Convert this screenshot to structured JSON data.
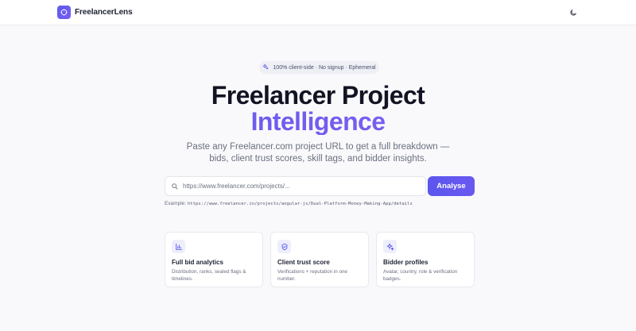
{
  "header": {
    "brand": "FreelancerLens",
    "logo_icon": "sparkle-logo-icon",
    "theme_icon": "moon-icon"
  },
  "hero": {
    "badge_icon": "sparkles-icon",
    "badge": "100% client-side · No signup · Ephemeral",
    "title_line1": "Freelancer Project",
    "title_line2": "Intelligence",
    "subtitle_line1": "Paste any Freelancer.com project URL to get a full breakdown —",
    "subtitle_line2": "bids, client trust scores, skill tags, and bidder insights."
  },
  "search": {
    "placeholder": "https://www.freelancer.com/projects/...",
    "value": "",
    "button_label": "Analyse",
    "example_label": "Example:",
    "example_url": "https://www.freelancer.in/projects/angular-js/Dual-Platform-Money-Making-App/details"
  },
  "features": [
    {
      "icon": "bar-chart-icon",
      "title": "Full bid analytics",
      "desc": "Distribution, ranks, sealed flags & timelines."
    },
    {
      "icon": "shield-check-icon",
      "title": "Client trust score",
      "desc": "Verifications + reputation in one number."
    },
    {
      "icon": "sparkles-icon",
      "title": "Bidder profiles",
      "desc": "Avatar, country, role & verification badges."
    }
  ],
  "colors": {
    "accent": "#5b57ee",
    "accent_end": "#8a63f0",
    "background": "#f9f9fb"
  }
}
